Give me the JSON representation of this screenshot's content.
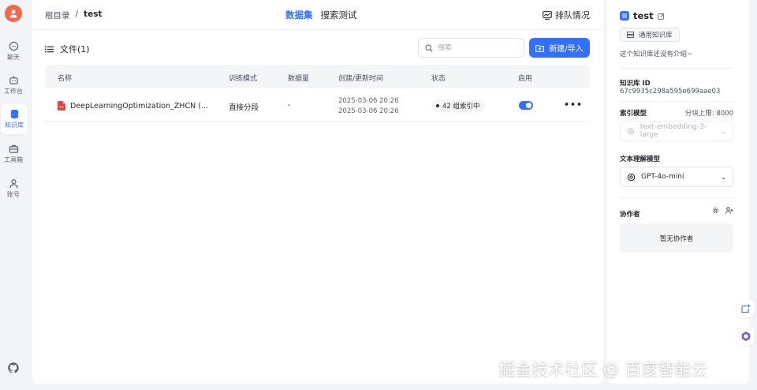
{
  "nav": {
    "items": [
      {
        "label": "聊天"
      },
      {
        "label": "工作台"
      },
      {
        "label": "知识库"
      },
      {
        "label": "工具箱"
      },
      {
        "label": "账号"
      }
    ]
  },
  "header": {
    "breadcrumb_root": "根目录",
    "breadcrumb_sep": "/",
    "breadcrumb_current": "test",
    "tabs": [
      "数据集",
      "搜索测试"
    ],
    "queue_label": "排队情况"
  },
  "files": {
    "title": "文件(1)",
    "search_placeholder": "搜索",
    "new_button": "新建/导入",
    "columns": [
      "名称",
      "训练模式",
      "数据量",
      "创建/更新时间",
      "状态",
      "启用"
    ],
    "rows": [
      {
        "name": "DeepLearningOptimization_ZHCN (...",
        "mode": "直接分段",
        "count": "-",
        "created": "2025-03-06 20:26",
        "updated": "2025-03-06 20:26",
        "status": "42 组索引中",
        "enabled": true,
        "more": "•••"
      }
    ]
  },
  "panel": {
    "title": "test",
    "kb_type": "通用知识库",
    "intro": "这个知识库还没有介绍~",
    "id_label": "知识库 ID",
    "id_value": "67c9935c298a595e699aae03",
    "index_model_label": "索引模型",
    "chunk_limit": "分块上限: 8000",
    "index_model_value": "text-embedding-3-large",
    "text_model_label": "文本理解模型",
    "text_model_value": "GPT-4o-mini",
    "collab_label": "协作者",
    "collab_empty": "暂无协作者"
  },
  "watermark": "掘金技术社区 @ 百度智能云",
  "colors": {
    "accent": "#3370ff",
    "avatar": "#ee6a4a",
    "file_icon": "#e0463d"
  }
}
